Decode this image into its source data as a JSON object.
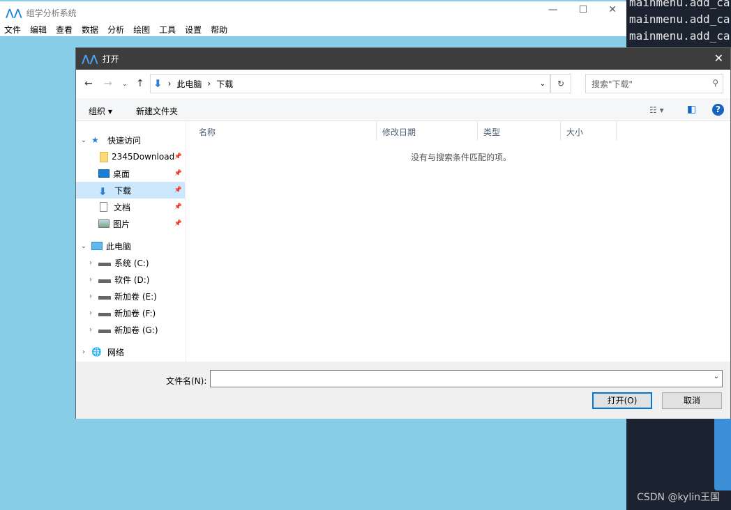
{
  "terminal": {
    "lines": [
      "mainmenu.add_ca",
      "mainmenu.add_ca",
      "mainmenu.add_ca"
    ]
  },
  "watermark": "CSDN @kylin王国",
  "app": {
    "title": "组学分析系统",
    "menu": [
      "文件",
      "编辑",
      "查看",
      "数据",
      "分析",
      "绘图",
      "工具",
      "设置",
      "帮助"
    ]
  },
  "dialog": {
    "title": "打开",
    "breadcrumb": [
      "此电脑",
      "下载"
    ],
    "search_placeholder": "搜索\"下载\"",
    "toolbar": {
      "organize": "组织 ▾",
      "new_folder": "新建文件夹",
      "help": "?"
    },
    "nav": {
      "quick_access": "快速访问",
      "quick_items": [
        {
          "label": "2345Download",
          "icon": "folder-icon"
        },
        {
          "label": "桌面",
          "icon": "desktop-icon"
        },
        {
          "label": "下载",
          "icon": "download-icon",
          "selected": true
        },
        {
          "label": "文档",
          "icon": "document-icon"
        },
        {
          "label": "图片",
          "icon": "pictures-icon"
        }
      ],
      "this_pc": "此电脑",
      "drives": [
        "系统 (C:)",
        "软件 (D:)",
        "新加卷 (E:)",
        "新加卷 (F:)",
        "新加卷 (G:)"
      ],
      "network": "网络"
    },
    "columns": [
      "名称",
      "修改日期",
      "类型",
      "大小"
    ],
    "empty_message": "没有与搜索条件匹配的项。",
    "filename_label": "文件名(N):",
    "filename_value": "",
    "open_label": "打开(O)",
    "cancel_label": "取消"
  }
}
